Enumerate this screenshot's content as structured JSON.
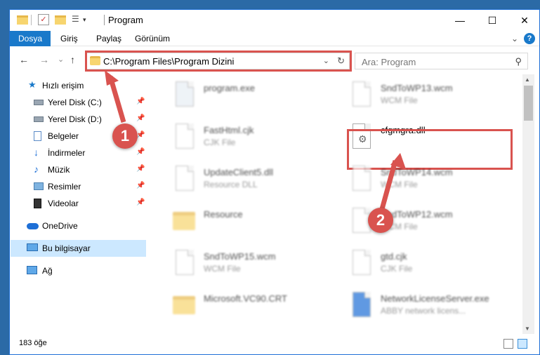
{
  "window": {
    "title": "Program",
    "controls": {
      "minimize": "—",
      "maximize": "☐",
      "close": "✕"
    }
  },
  "ribbon": {
    "tabs": [
      {
        "label": "Dosya"
      },
      {
        "label": "Giriş"
      },
      {
        "label": "Paylaş"
      },
      {
        "label": "Görünüm"
      }
    ],
    "help": "?"
  },
  "nav": {
    "back": "←",
    "forward": "→",
    "recent": "⌄",
    "up": "↑",
    "address": "C:\\Program Files\\Program Dizini",
    "search_placeholder": "Ara: Program"
  },
  "sidebar": {
    "items": [
      {
        "label": "Hızlı erişim",
        "icon": "star-icon"
      },
      {
        "label": "Yerel Disk (C:)",
        "icon": "drive-icon",
        "pinned": true
      },
      {
        "label": "Yerel Disk (D:)",
        "icon": "drive-icon",
        "pinned": true
      },
      {
        "label": "Belgeler",
        "icon": "documents-icon",
        "pinned": true
      },
      {
        "label": "İndirmeler",
        "icon": "download-icon",
        "pinned": true
      },
      {
        "label": "Müzik",
        "icon": "music-icon",
        "pinned": true
      },
      {
        "label": "Resimler",
        "icon": "pictures-icon",
        "pinned": true
      },
      {
        "label": "Videolar",
        "icon": "videos-icon",
        "pinned": true
      },
      {
        "label": "OneDrive",
        "icon": "cloud-icon"
      },
      {
        "label": "Bu bilgisayar",
        "icon": "computer-icon",
        "selected": true
      },
      {
        "label": "Ağ",
        "icon": "network-icon"
      }
    ]
  },
  "files": [
    {
      "name": "program.exe",
      "type": "",
      "kind": "exe"
    },
    {
      "name": "SndToWP13.wcm",
      "type": "WCM File",
      "kind": "doc"
    },
    {
      "name": "FastHtml.cjk",
      "type": "CJK File",
      "kind": "doc"
    },
    {
      "name": "cfgmgra.dll",
      "type": "",
      "kind": "dll"
    },
    {
      "name": "UpdateClient5.dll",
      "type": "Resource DLL",
      "kind": "dll"
    },
    {
      "name": "SndToWP14.wcm",
      "type": "WCM File",
      "kind": "doc"
    },
    {
      "name": "Resource",
      "type": "",
      "kind": "folder"
    },
    {
      "name": "SndToWP12.wcm",
      "type": "WCM File",
      "kind": "doc"
    },
    {
      "name": "SndToWP15.wcm",
      "type": "WCM File",
      "kind": "doc"
    },
    {
      "name": "gtd.cjk",
      "type": "CJK File",
      "kind": "doc"
    },
    {
      "name": "Microsoft.VC90.CRT",
      "type": "",
      "kind": "folder"
    },
    {
      "name": "NetworkLicenseServer.exe",
      "type": "ABBY network licens...",
      "kind": "exe"
    }
  ],
  "status": {
    "count": "183 öğe"
  },
  "annotations": {
    "step1": "1",
    "step2": "2"
  },
  "colors": {
    "accent": "#1979ca",
    "highlight": "#d9534f",
    "selected": "#cce8ff"
  }
}
